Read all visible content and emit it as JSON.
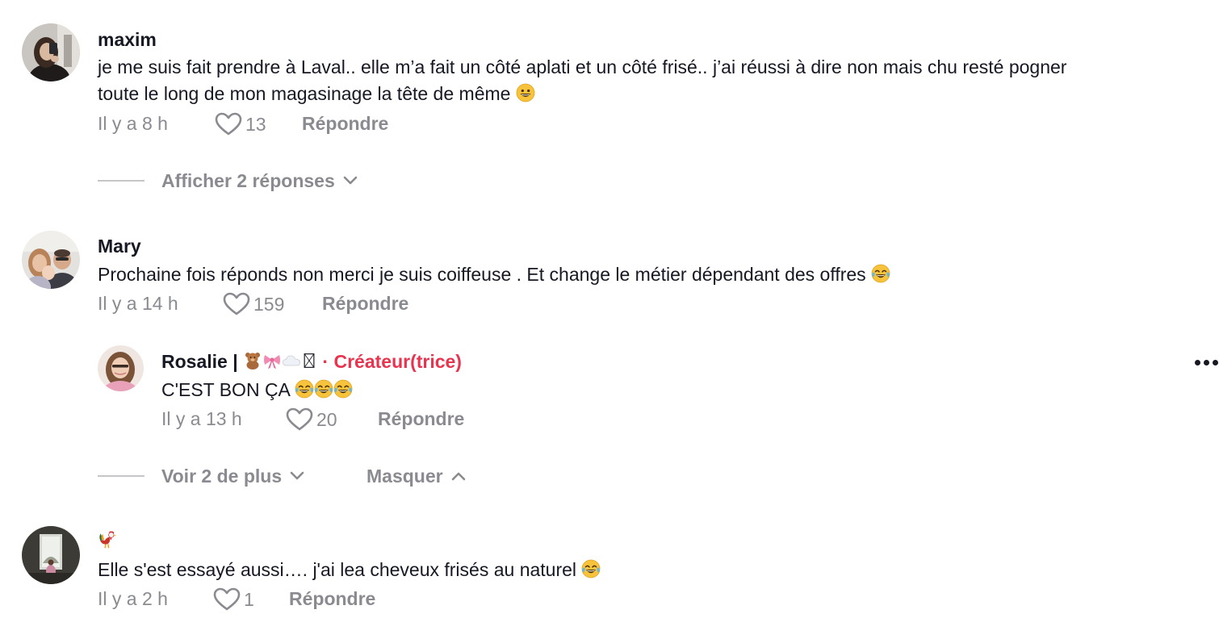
{
  "comments": [
    {
      "username": "maxim",
      "text_line1": "je me suis fait prendre à Laval.. elle m’a fait un côté aplati et un côté frisé.. j’ai réussi à dire non mais chu resté pogner",
      "text_line2": "toute le long de mon magasinage la tête de même",
      "text_emoji": "grinning-face",
      "time": "Il y a 8 h",
      "likes": "13",
      "reply_label": "Répondre",
      "replies_toggle": "Afficher 2 réponses"
    },
    {
      "username": "Mary",
      "text": "Prochaine fois réponds non merci je suis coiffeuse . Et change le métier dépendant des offres",
      "text_emoji": "face-with-tears-of-joy",
      "time": "Il y a 14 h",
      "likes": "159",
      "reply_label": "Répondre",
      "reply": {
        "username": "Rosalie |",
        "username_emojis": [
          "teddy-bear",
          "ribbon",
          "cloud",
          "missing-glyph"
        ],
        "badge": "· Créateur(trice)",
        "text": "C'EST BON ÇA",
        "text_emojis": [
          "face-with-tears-of-joy",
          "face-with-tears-of-joy",
          "face-with-tears-of-joy"
        ],
        "time": "Il y a 13 h",
        "likes": "20",
        "reply_label": "Répondre"
      },
      "more_toggle": "Voir 2 de plus",
      "hide_toggle": "Masquer"
    },
    {
      "username_emoji": "rooster",
      "text": "Elle s'est essayé aussi…. j'ai lea cheveux frisés au naturel",
      "text_emoji": "face-with-tears-of-joy",
      "time": "Il y a 2 h",
      "likes": "1",
      "reply_label": "Répondre"
    }
  ],
  "colors": {
    "text": "#161823",
    "muted": "#8a8b91",
    "creator": "#e8344e",
    "divider": "#c6c6c9"
  }
}
